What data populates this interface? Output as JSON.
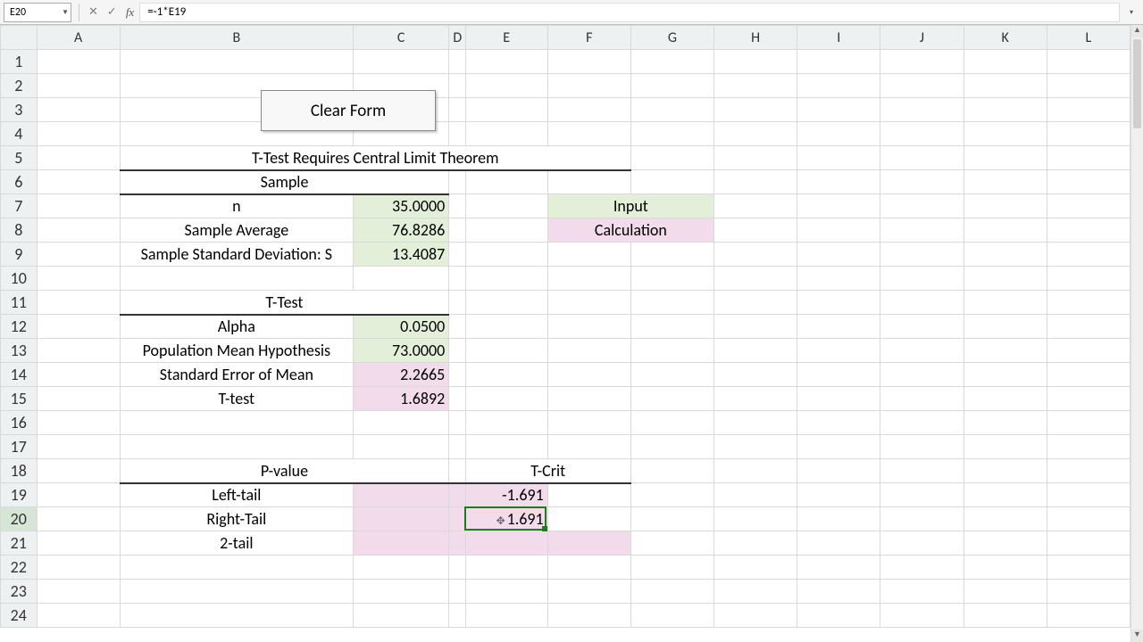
{
  "namebox": "E20",
  "formula": "=-1*E19",
  "columns": [
    "A",
    "B",
    "C",
    "D",
    "E",
    "F",
    "G",
    "H",
    "I",
    "J",
    "K",
    "L"
  ],
  "row_count": 24,
  "active": {
    "col": "E",
    "row": 20
  },
  "button": {
    "clear_form": "Clear Form"
  },
  "labels": {
    "title": "T-Test Requires Central Limit Theorem",
    "sample": "Sample",
    "n": "n",
    "sample_avg": "Sample Average",
    "sample_sd": "Sample Standard Deviation: S",
    "ttest_hdr": "T-Test",
    "alpha": "Alpha",
    "pop_mean": "Population Mean Hypothesis",
    "sem": "Standard Error of Mean",
    "ttest": "T-test",
    "pvalue": "P-value",
    "tcrit": "T-Crit",
    "left": "Left-tail",
    "right": "Right-Tail",
    "two": "2-tail",
    "legend_input": "Input",
    "legend_calc": "Calculation"
  },
  "values": {
    "n": "35.0000",
    "sample_avg": "76.8286",
    "sample_sd": "13.4087",
    "alpha": "0.0500",
    "pop_mean": "73.0000",
    "sem": "2.2665",
    "ttest": "1.6892",
    "tcrit_left": "-1.691",
    "tcrit_right": "1.691"
  },
  "colors": {
    "input_bg": "#e3efd9",
    "calc_bg": "#f2dceb",
    "selection": "#1a7f1a"
  }
}
